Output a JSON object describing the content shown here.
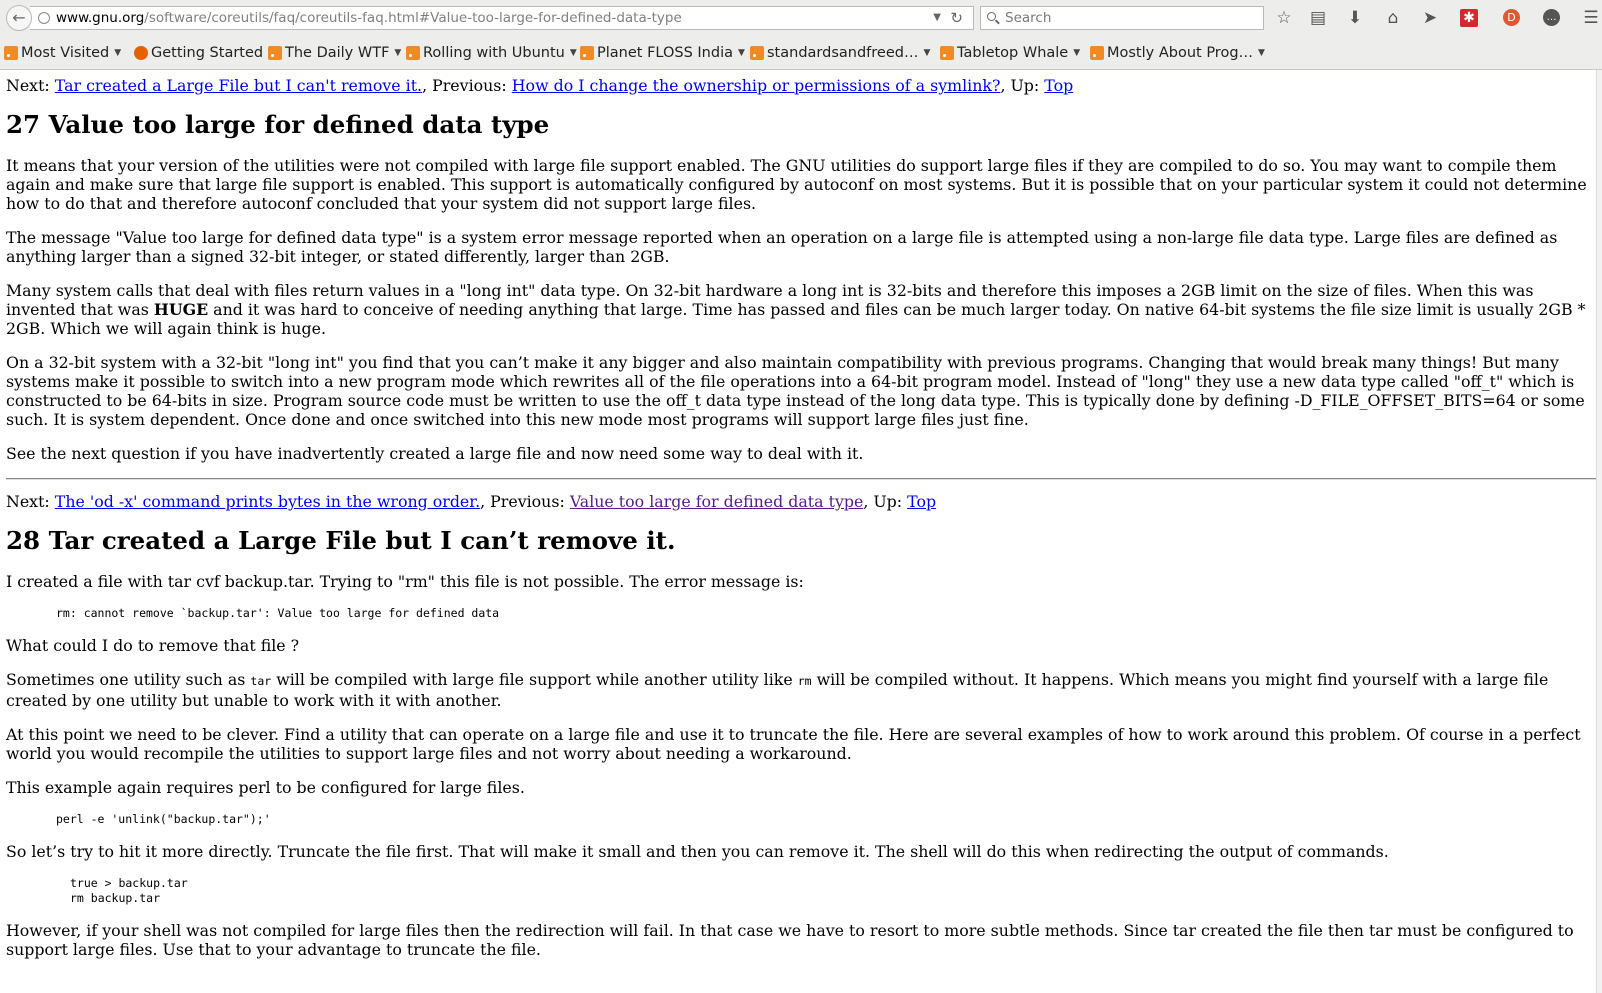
{
  "browser": {
    "url_host": "www.gnu.org",
    "url_rest": "/software/coreutils/faq/coreutils-faq.html#Value-too-large-for-defined-data-type",
    "search_placeholder": "Search",
    "bookmarks": [
      {
        "label": "Most Visited",
        "icon": "rss-icon",
        "menu": true
      },
      {
        "label": "Getting Started",
        "icon": "firefox-icon",
        "menu": false
      },
      {
        "label": "The Daily WTF",
        "icon": "rss-icon",
        "menu": true
      },
      {
        "label": "Rolling with Ubuntu",
        "icon": "rss-icon",
        "menu": true
      },
      {
        "label": "Planet FLOSS India",
        "icon": "rss-icon",
        "menu": true
      },
      {
        "label": "standardsandfreed…",
        "icon": "rss-icon",
        "menu": true
      },
      {
        "label": "Tabletop Whale",
        "icon": "rss-icon",
        "menu": true
      },
      {
        "label": "Mostly About Prog…",
        "icon": "rss-icon",
        "menu": true
      }
    ]
  },
  "sec27": {
    "nav": {
      "next_label": "Next:",
      "next_link": "Tar created a Large File but I can't remove it.",
      "prev_label": ", Previous:",
      "prev_link": "How do I change the ownership or permissions of a symlink?",
      "up_label": ", Up:",
      "up_link": "Top"
    },
    "title": "27 Value too large for defined data type",
    "p1": "It means that your version of the utilities were not compiled with large file support enabled. The GNU utilities do support large files if they are compiled to do so. You may want to compile them again and make sure that large file support is enabled. This support is automatically configured by autoconf on most systems. But it is possible that on your particular system it could not determine how to do that and therefore autoconf concluded that your system did not support large files.",
    "p2": "The message \"Value too large for defined data type\" is a system error message reported when an operation on a large file is attempted using a non-large file data type. Large files are defined as anything larger than a signed 32-bit integer, or stated differently, larger than 2GB.",
    "p3_a": "Many system calls that deal with files return values in a \"long int\" data type. On 32-bit hardware a long int is 32-bits and therefore this imposes a 2GB limit on the size of files. When this was invented that was ",
    "p3_bold": "HUGE",
    "p3_b": " and it was hard to conceive of needing anything that large. Time has passed and files can be much larger today. On native 64-bit systems the file size limit is usually 2GB * 2GB. Which we will again think is huge.",
    "p4": "On a 32-bit system with a 32-bit \"long int\" you find that you can’t make it any bigger and also maintain compatibility with previous programs. Changing that would break many things! But many systems make it possible to switch into a new program mode which rewrites all of the file operations into a 64-bit program model. Instead of \"long\" they use a new data type called \"off_t\" which is constructed to be 64-bits in size. Program source code must be written to use the off_t data type instead of the long data type. This is typically done by defining -D_FILE_OFFSET_BITS=64 or some such. It is system dependent. Once done and once switched into this new mode most programs will support large files just fine.",
    "p5": "See the next question if you have inadvertently created a large file and now need some way to deal with it."
  },
  "sec28": {
    "nav": {
      "next_label": "Next:",
      "next_link": "The 'od -x' command prints bytes in the wrong order.",
      "prev_label": ", Previous:",
      "prev_link": "Value too large for defined data type",
      "up_label": ", Up:",
      "up_link": "Top"
    },
    "title": "28 Tar created a Large File but I can’t remove it.",
    "p1": "I created a file with tar cvf backup.tar. Trying to \"rm\" this file is not possible. The error message is:",
    "code1": "rm: cannot remove `backup.tar': Value too large for defined data",
    "p2": "What could I do to remove that file ?",
    "p3_a": "Sometimes one utility such as ",
    "p3_code1": "tar",
    "p3_b": " will be compiled with large file support while another utility like ",
    "p3_code2": "rm",
    "p3_c": " will be compiled without. It happens. Which means you might find yourself with a large file created by one utility but unable to work with it with another.",
    "p4": "At this point we need to be clever. Find a utility that can operate on a large file and use it to truncate the file. Here are several examples of how to work around this problem. Of course in a perfect world you would recompile the utilities to support large files and not worry about needing a workaround.",
    "p5": "This example again requires perl to be configured for large files.",
    "code2": "perl -e 'unlink(\"backup.tar\");'",
    "p6": "So let’s try to hit it more directly. Truncate the file first. That will make it small and then you can remove it. The shell will do this when redirecting the output of commands.",
    "code3": "true > backup.tar\nrm backup.tar",
    "p7": "However, if your shell was not compiled for large files then the redirection will fail. In that case we have to resort to more subtle methods. Since tar created the file then tar must be configured to support large files. Use that to your advantage to truncate the file."
  }
}
